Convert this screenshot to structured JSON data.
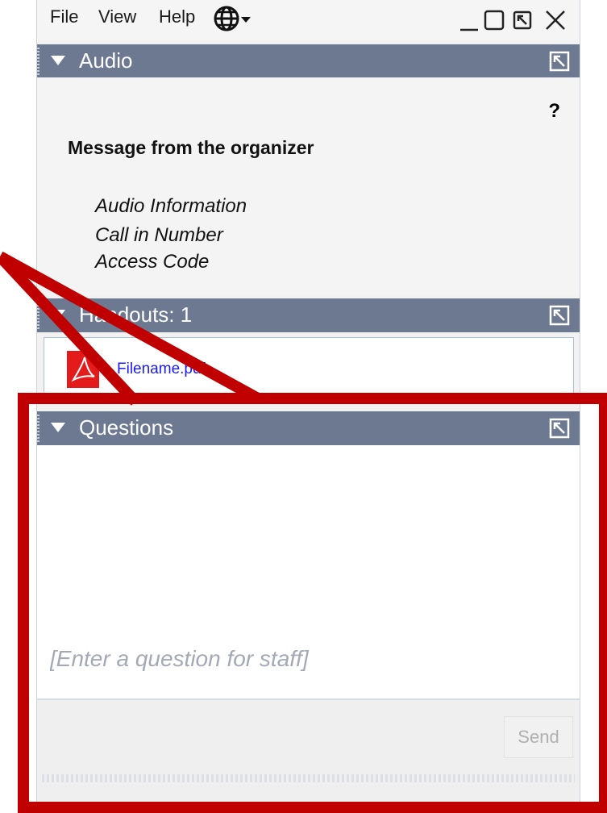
{
  "menubar": {
    "file": "File",
    "view": "View",
    "help": "Help",
    "language_icon": "globe-icon",
    "window_controls": [
      "minimize-icon",
      "maximize-icon",
      "restore-icon",
      "close-icon"
    ]
  },
  "audio": {
    "header": "Audio",
    "help": "?",
    "message_title": "Message from the organizer",
    "lines": [
      "Audio Information",
      "Call in Number",
      "Access Code"
    ]
  },
  "handouts": {
    "header": "Handouts: 1",
    "file_name": "Filename.pdf",
    "file_icon": "pdf-icon"
  },
  "questions": {
    "header": "Questions",
    "input_placeholder": "[Enter a question for staff]",
    "send_label": "Send"
  },
  "colors": {
    "header_bg": "#6d7891",
    "annotation_red": "#c00000",
    "link_blue": "#1a1aff"
  }
}
